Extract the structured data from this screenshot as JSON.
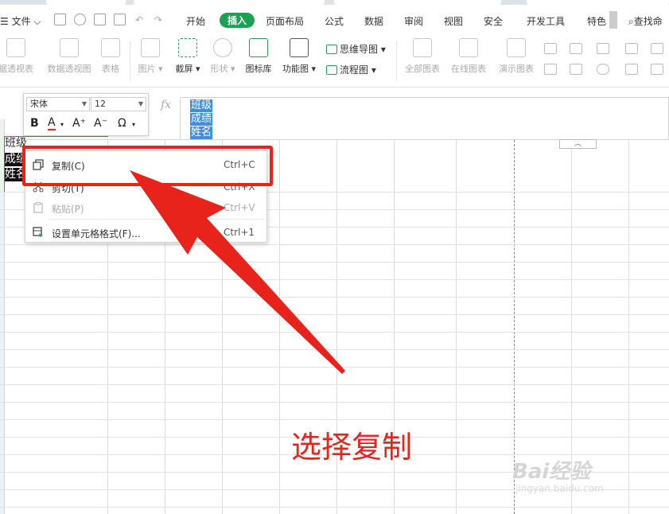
{
  "menu": {
    "file": "文件",
    "tabs": [
      "开始",
      "插入",
      "页面布局",
      "公式",
      "数据",
      "审阅",
      "视图",
      "安全",
      "开发工具",
      "特色"
    ],
    "active_tab": "插入",
    "search": "查找命"
  },
  "toolbar": {
    "items": [
      "据透视表",
      "数据透视图",
      "表格",
      "图片",
      "截屏",
      "形状",
      "图标库",
      "功能图",
      "全部图表",
      "在线图表",
      "演示图表"
    ],
    "mindmap": "思维导图",
    "flowchart": "流程图"
  },
  "font": {
    "name": "宋体",
    "size": "12"
  },
  "format_buttons": [
    "B",
    "A",
    "A⁺",
    "A⁻",
    "Ω"
  ],
  "formula_bar": {
    "fx": "fx",
    "lines": [
      "班级",
      "成绩",
      "姓名"
    ]
  },
  "cell": {
    "lines": [
      "班级",
      "成绩",
      "姓名"
    ]
  },
  "context_menu": [
    {
      "label": "复制(C)",
      "shortcut": "Ctrl+C",
      "icon": "copy-icon"
    },
    {
      "label": "剪切(T)",
      "shortcut": "Ctrl+X",
      "icon": "scissors-icon"
    },
    {
      "label": "粘贴(P)",
      "shortcut": "Ctrl+V",
      "icon": "paste-icon"
    },
    {
      "label": "设置单元格格式(F)...",
      "shortcut": "Ctrl+1",
      "icon": "format-cells-icon"
    }
  ],
  "annotation": "选择复制",
  "watermark": {
    "main": "Bai经验",
    "sub": "jingyan.baidu.com"
  },
  "colors": {
    "accent": "#1aa154",
    "highlight": "#e8231c",
    "selection": "#3d8fe6"
  }
}
